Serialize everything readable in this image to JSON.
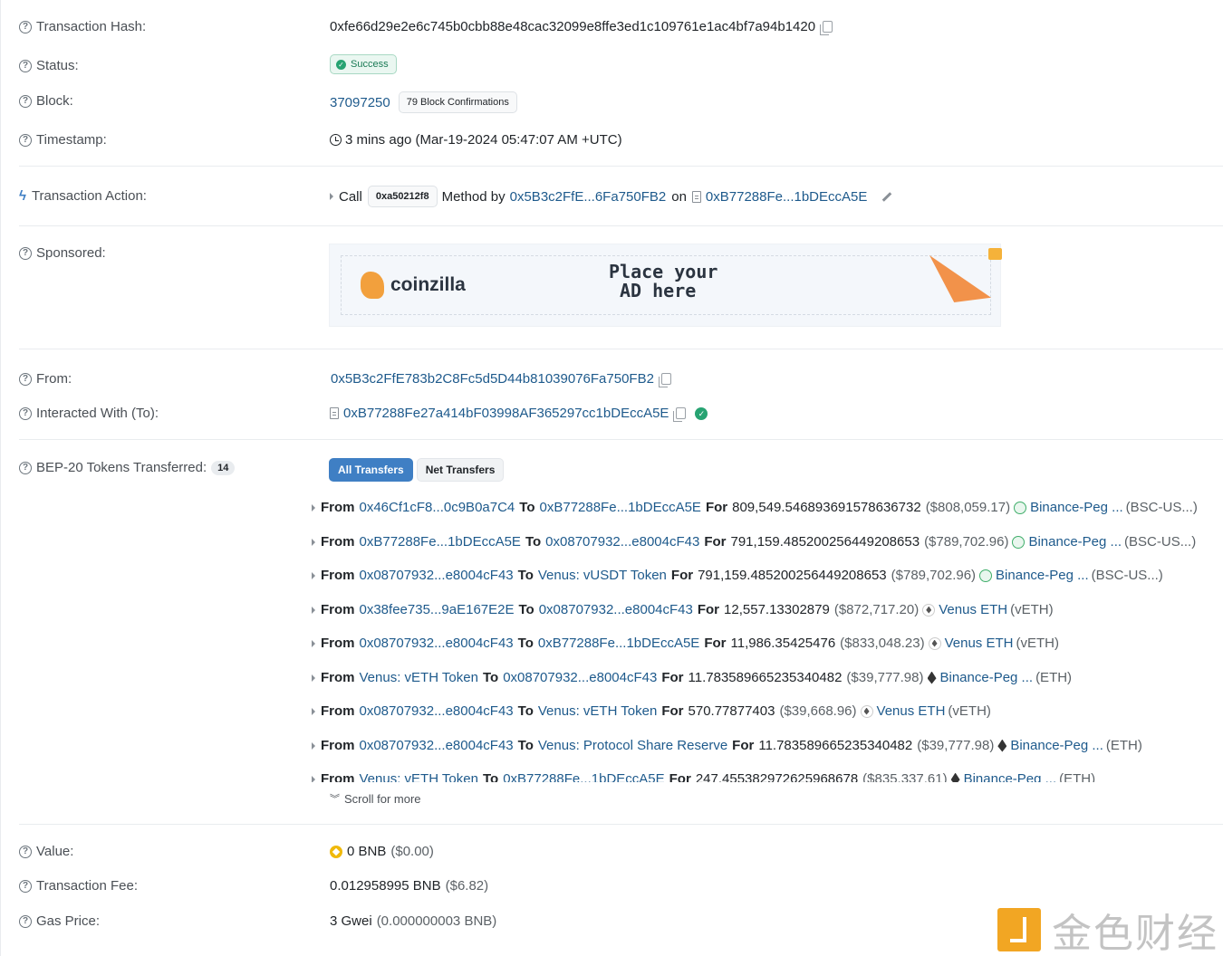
{
  "fields": {
    "tx_hash": {
      "label": "Transaction Hash:",
      "value": "0xfe66d29e2e6c745b0cbb88e48cac32099e8ffe3ed1c109761e1ac4bf7a94b1420"
    },
    "status": {
      "label": "Status:",
      "value": "Success"
    },
    "block": {
      "label": "Block:",
      "value": "37097250",
      "confirmations": "79 Block Confirmations"
    },
    "timestamp": {
      "label": "Timestamp:",
      "value": "3 mins ago (Mar-19-2024 05:47:07 AM +UTC)"
    },
    "action": {
      "label": "Transaction Action:",
      "call": "Call",
      "method": "0xa50212f8",
      "method_by": "Method by",
      "by_address": "0x5B3c2FfE...6Fa750FB2",
      "on": "on",
      "on_address": "0xB77288Fe...1bDEccA5E"
    },
    "sponsored": {
      "label": "Sponsored:",
      "ad_brand": "coinzilla",
      "ad_line1": "Place your",
      "ad_line2": "AD here"
    },
    "from": {
      "label": "From:",
      "value": "0x5B3c2FfE783b2C8Fc5d5D44b81039076Fa750FB2"
    },
    "to": {
      "label": "Interacted With (To):",
      "value": "0xB77288Fe27a414bF03998AF365297cc1bDEccA5E"
    },
    "tokens": {
      "label": "BEP-20 Tokens Transferred:",
      "count": "14",
      "tab_all": "All Transfers",
      "tab_net": "Net Transfers",
      "scroll_more": "Scroll for more"
    },
    "value": {
      "label": "Value:",
      "value": "0 BNB",
      "usd": "($0.00)"
    },
    "fee": {
      "label": "Transaction Fee:",
      "value": "0.012958995 BNB",
      "usd": "($6.82)"
    },
    "gas": {
      "label": "Gas Price:",
      "value": "3 Gwei",
      "bnb": "(0.000000003 BNB)"
    }
  },
  "transfers": [
    {
      "from": "0x46Cf1cF8...0c9B0a7C4",
      "to": "0xB77288Fe...1bDEccA5E",
      "amount": "809,549.546893691578636732",
      "usd": "($808,059.17)",
      "icon": "usd",
      "token": "Binance-Peg ...",
      "symbol": "(BSC-US...)"
    },
    {
      "from": "0xB77288Fe...1bDEccA5E",
      "to": "0x08707932...e8004cF43",
      "amount": "791,159.485200256449208653",
      "usd": "($789,702.96)",
      "icon": "usd",
      "token": "Binance-Peg ...",
      "symbol": "(BSC-US...)"
    },
    {
      "from": "0x08707932...e8004cF43",
      "to": "Venus: vUSDT Token",
      "amount": "791,159.485200256449208653",
      "usd": "($789,702.96)",
      "icon": "usd",
      "token": "Binance-Peg ...",
      "symbol": "(BSC-US...)"
    },
    {
      "from": "0x38fee735...9aE167E2E",
      "to": "0x08707932...e8004cF43",
      "amount": "12,557.13302879",
      "usd": "($872,717.20)",
      "icon": "veth",
      "token": "Venus ETH",
      "symbol": "(vETH)"
    },
    {
      "from": "0x08707932...e8004cF43",
      "to": "0xB77288Fe...1bDEccA5E",
      "amount": "11,986.35425476",
      "usd": "($833,048.23)",
      "icon": "veth",
      "token": "Venus ETH",
      "symbol": "(vETH)"
    },
    {
      "from": "Venus: vETH Token",
      "to": "0x08707932...e8004cF43",
      "amount": "11.783589665235340482",
      "usd": "($39,777.98)",
      "icon": "eth",
      "token": "Binance-Peg ...",
      "symbol": "(ETH)"
    },
    {
      "from": "0x08707932...e8004cF43",
      "to": "Venus: vETH Token",
      "amount": "570.77877403",
      "usd": "($39,668.96)",
      "icon": "veth",
      "token": "Venus ETH",
      "symbol": "(vETH)"
    },
    {
      "from": "0x08707932...e8004cF43",
      "to": "Venus: Protocol Share Reserve",
      "amount": "11.783589665235340482",
      "usd": "($39,777.98)",
      "icon": "eth",
      "token": "Binance-Peg ...",
      "symbol": "(ETH)"
    },
    {
      "from": "Venus: vETH Token",
      "to": "0xB77288Fe...1bDEccA5E",
      "amount": "247.455382972625968678",
      "usd": "($835,337.61)",
      "icon": "eth",
      "token": "Binance-Peg ...",
      "symbol": "(ETH)"
    }
  ],
  "transfer_words": {
    "from": "From",
    "to": "To",
    "for": "For"
  },
  "watermark": {
    "text": "金色财经"
  },
  "colors": {
    "link": "#1e5a8c",
    "success": "#27a372",
    "tab_active": "#3f7fc4"
  }
}
